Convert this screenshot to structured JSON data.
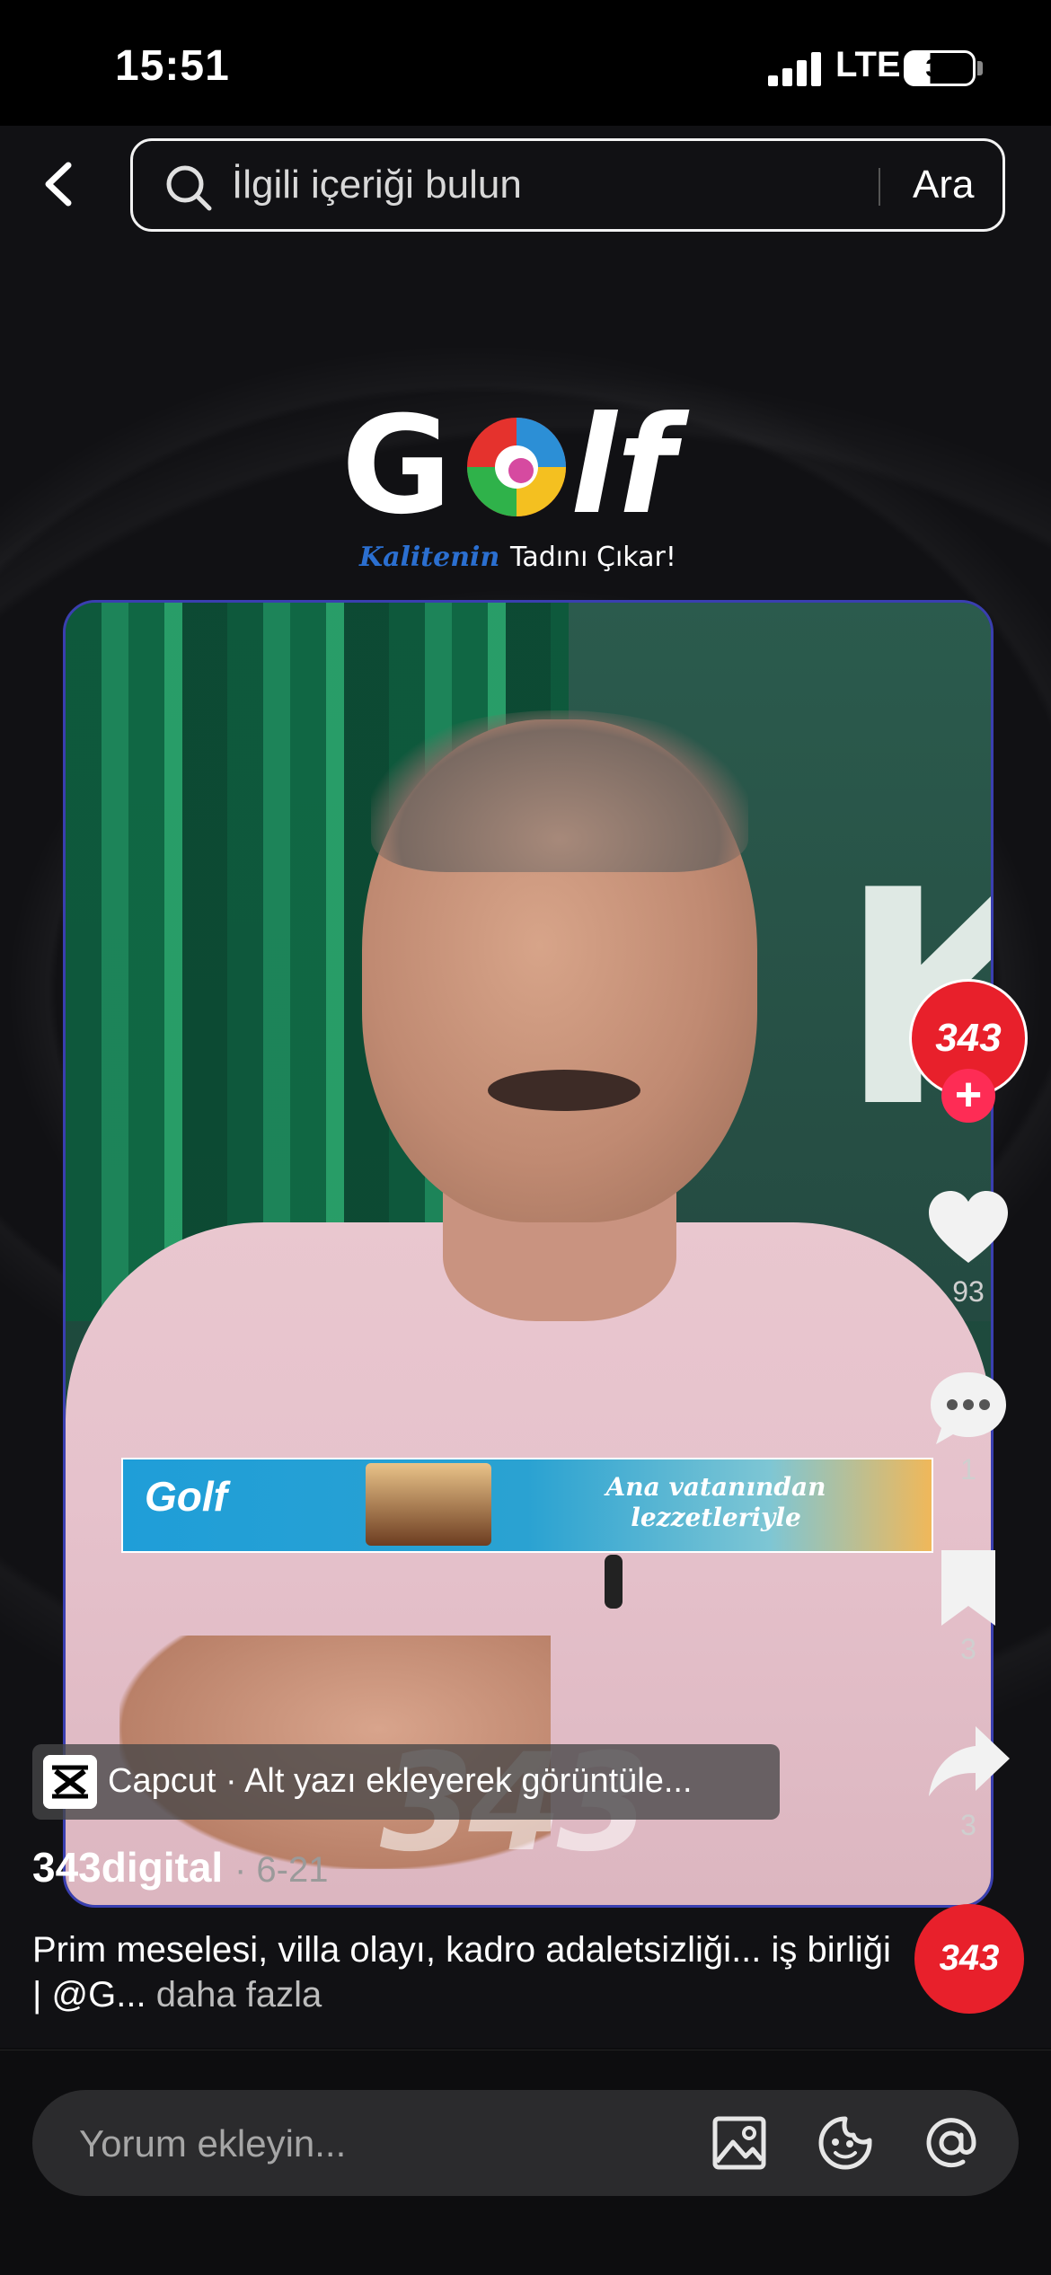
{
  "status_bar": {
    "time": "15:51",
    "network": "LTE",
    "battery": "36"
  },
  "search": {
    "placeholder": "İlgili içeriği bulun",
    "button_label": "Ara"
  },
  "ad": {
    "brand": "Golf",
    "tagline_blue": "Kalitenin",
    "tagline_white": "Tadını Çıkar!"
  },
  "video": {
    "banner_brand": "Golf",
    "banner_text": "Ana vatanından lezzetleriyle",
    "watermark": "343"
  },
  "capcut": {
    "label": "Capcut · Alt yazı ekleyerek görüntüle..."
  },
  "post": {
    "author": "343digital",
    "date": "· 6-21",
    "caption": "Prim meselesi, villa olayı, kadro adaletsizliği... iş birliği | @G...",
    "more": "daha fazla"
  },
  "rail": {
    "avatar_text": "343",
    "follow_icon": "plus-icon",
    "likes": "93",
    "comments": "1",
    "saves": "3",
    "shares": "3",
    "music_text": "343"
  },
  "comment_bar": {
    "placeholder": "Yorum ekleyin..."
  },
  "colors": {
    "accent_red": "#fe2c55",
    "avatar_red": "#e8202b"
  }
}
